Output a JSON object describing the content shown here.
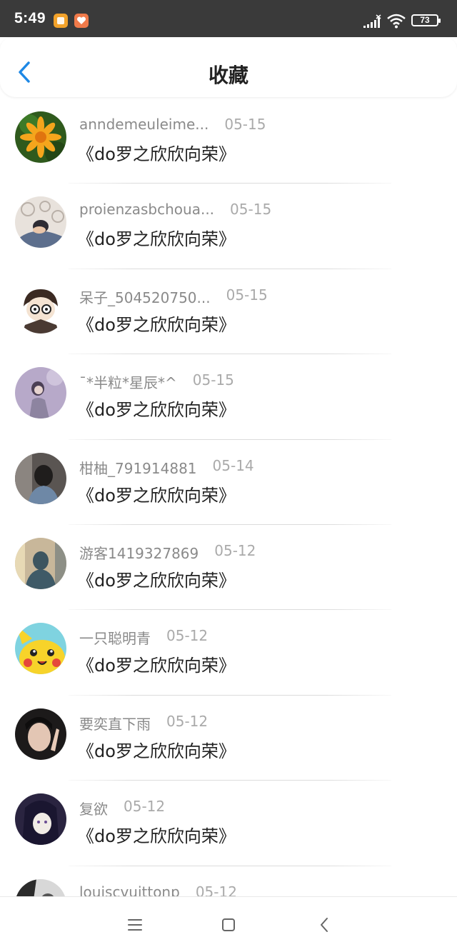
{
  "status_bar": {
    "time": "5:49",
    "battery": "73"
  },
  "header": {
    "title": "收藏"
  },
  "items": [
    {
      "name": "anndemeuleime...",
      "date": "05-15",
      "title": "《do罗之欣欣向荣》"
    },
    {
      "name": "proienzasbchoua...",
      "date": "05-15",
      "title": "《do罗之欣欣向荣》"
    },
    {
      "name": "呆子_504520750...",
      "date": "05-15",
      "title": "《do罗之欣欣向荣》"
    },
    {
      "name": "ˉ*半粒*星辰*^",
      "date": "05-15",
      "title": "《do罗之欣欣向荣》"
    },
    {
      "name": "柑柚_791914881",
      "date": "05-14",
      "title": "《do罗之欣欣向荣》"
    },
    {
      "name": "游客1419327869",
      "date": "05-12",
      "title": "《do罗之欣欣向荣》"
    },
    {
      "name": "一只聪明青",
      "date": "05-12",
      "title": "《do罗之欣欣向荣》"
    },
    {
      "name": "要奕直下雨",
      "date": "05-12",
      "title": "《do罗之欣欣向荣》"
    },
    {
      "name": "复欲",
      "date": "05-12",
      "title": "《do罗之欣欣向荣》"
    },
    {
      "name": "louiscvuittonp",
      "date": "05-12",
      "title": ""
    }
  ],
  "nav": {
    "menu_icon": "menu-icon",
    "home_icon": "square-icon",
    "back_icon": "triangle-back-icon"
  },
  "colors": {
    "accent": "#1e88e5",
    "status_bar": "#3a3a3a",
    "text_primary": "#222222",
    "text_secondary": "#8a8a8a"
  }
}
